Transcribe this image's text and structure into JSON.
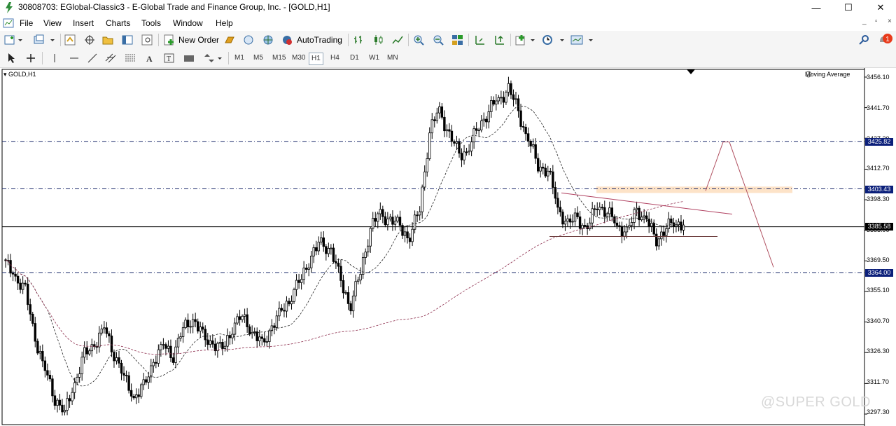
{
  "window": {
    "title": "30808703: EGlobal-Classic3 - E-Global Trade and Finance Group, Inc. - [GOLD,H1]",
    "controls": [
      "—",
      "☐",
      "✕"
    ]
  },
  "menu": {
    "items": [
      "File",
      "View",
      "Insert",
      "Charts",
      "Tools",
      "Window",
      "Help"
    ],
    "mdi_controls": [
      "_",
      "▫",
      "×"
    ]
  },
  "toolbar": {
    "new_order_label": "New Order",
    "autotrading_label": "AutoTrading",
    "timeframes": [
      "M1",
      "M5",
      "M15",
      "M30",
      "H1",
      "H4",
      "D1",
      "W1",
      "MN"
    ],
    "selected_timeframe": "H1",
    "notification_badge": "1"
  },
  "chart": {
    "symbol_label": "GOLD,H1",
    "indicator_label": "Moving Average",
    "price_axis": [
      "3456.10",
      "3441.70",
      "3427.30",
      "3412.70",
      "3398.30",
      "3383.90",
      "3369.50",
      "3355.10",
      "3340.70",
      "3326.30",
      "3311.70",
      "3297.30"
    ],
    "level_tags": [
      {
        "label": "3425.82",
        "color": "#0b1f7a"
      },
      {
        "label": "3403.43",
        "color": "#0b1f7a"
      },
      {
        "label": "3385.58",
        "color": "#000000"
      },
      {
        "label": "3364.00",
        "color": "#0b1f7a"
      }
    ],
    "watermark": "@SUPER GOLD"
  },
  "chart_data": {
    "type": "candlestick",
    "symbol": "GOLD",
    "timeframe": "H1",
    "ylim": [
      3297.3,
      3456.1
    ],
    "current_price": 3385.58,
    "horizontal_levels": [
      3425.82,
      3403.43,
      3385.58,
      3364.0
    ],
    "resistance_zone": [
      3401.5,
      3404.5
    ],
    "close_path": [
      3368,
      3362,
      3355,
      3333,
      3318,
      3305,
      3298,
      3312,
      3325,
      3330,
      3338,
      3326,
      3315,
      3305,
      3310,
      3322,
      3330,
      3325,
      3338,
      3342,
      3334,
      3330,
      3328,
      3338,
      3344,
      3336,
      3330,
      3338,
      3346,
      3353,
      3362,
      3372,
      3378,
      3374,
      3360,
      3348,
      3365,
      3385,
      3392,
      3388,
      3386,
      3380,
      3395,
      3430,
      3441,
      3428,
      3420,
      3422,
      3434,
      3440,
      3446,
      3450,
      3440,
      3426,
      3415,
      3412,
      3395,
      3386,
      3390,
      3384,
      3397,
      3392,
      3387,
      3382,
      3394,
      3388,
      3380,
      3385,
      3388,
      3386
    ]
  }
}
